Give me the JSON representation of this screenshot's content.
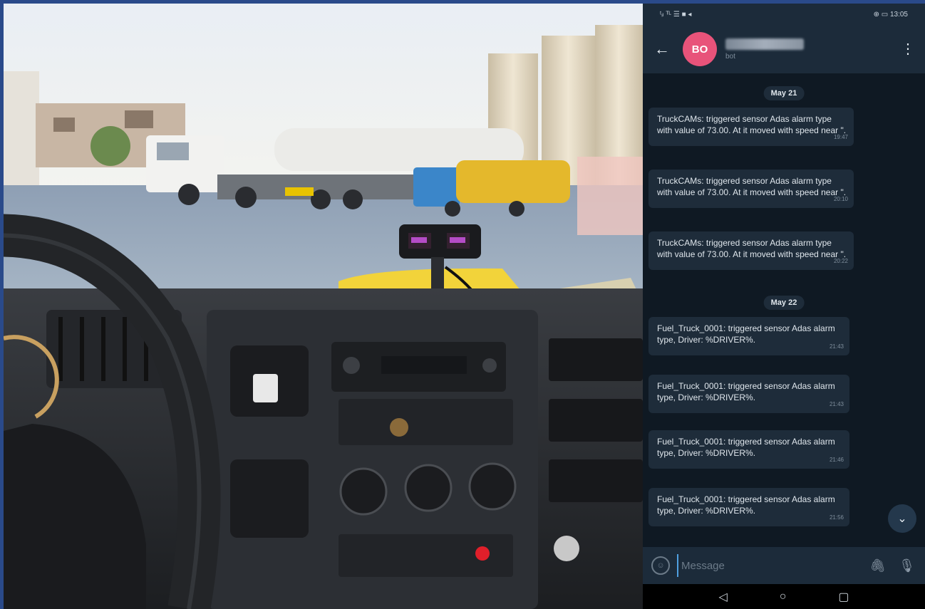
{
  "status_bar": {
    "left_text": "ᵗᵢₗ ᵀᴸ ☰ ■ ◂",
    "right_text": "⊕ ▭ 13:05"
  },
  "header": {
    "back_icon": "←",
    "avatar_initials": "BO",
    "contact_status": "bot",
    "menu_icon": "⋮"
  },
  "chat": {
    "date_pills": [
      "May 21",
      "May 22"
    ],
    "messages": [
      {
        "text": "TruckCAMs: triggered sensor Adas alarm type with value of 73.00. At it moved with speed near \".",
        "time": "19:47"
      },
      {
        "text": "TruckCAMs: triggered sensor Adas alarm type with value of 73.00. At it moved with speed near \".",
        "time": "20:10"
      },
      {
        "text": "TruckCAMs: triggered sensor Adas alarm type with value of 73.00. At it moved with speed near \".",
        "time": "20:22"
      },
      {
        "text": "Fuel_Truck_0001: triggered sensor Adas alarm type, Driver: %DRIVER%.",
        "time": "21:43"
      },
      {
        "text": "Fuel_Truck_0001: triggered sensor Adas alarm type, Driver: %DRIVER%.",
        "time": "21:43"
      },
      {
        "text": "Fuel_Truck_0001: triggered sensor Adas alarm type, Driver: %DRIVER%.",
        "time": "21:46"
      },
      {
        "text": "Fuel_Truck_0001: triggered sensor Adas alarm type, Driver: %DRIVER%.",
        "time": "21:56"
      }
    ],
    "scroll_down_icon": "⌄"
  },
  "composer": {
    "emoji_icon": "☺",
    "placeholder": "Message",
    "attach_icon": "🖇",
    "mic_icon": "🎙"
  },
  "nav": {
    "back": "◁",
    "home": "○",
    "recents": "▢"
  },
  "colors": {
    "frame": "#2a4a8a",
    "chat_bg": "#0f1923",
    "bubble": "#1e2c3a",
    "avatar": "#e8537a"
  }
}
